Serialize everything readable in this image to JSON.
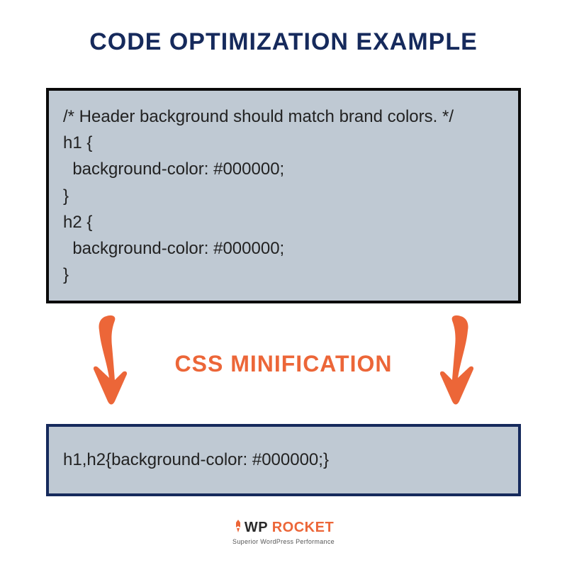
{
  "title": "CODE OPTIMIZATION EXAMPLE",
  "code_before": "/* Header background should match brand colors. */\nh1 {\n  background-color: #000000;\n}\nh2 {\n  background-color: #000000;\n}",
  "arrow_label": "CSS MINIFICATION",
  "code_after": "h1,h2{background-color: #000000;}",
  "logo": {
    "wp": "WP",
    "rocket": "ROCKET",
    "tagline": "Superior WordPress Performance"
  },
  "colors": {
    "primary": "#162a5c",
    "accent": "#ec6638",
    "code_bg": "#bfc9d3"
  }
}
